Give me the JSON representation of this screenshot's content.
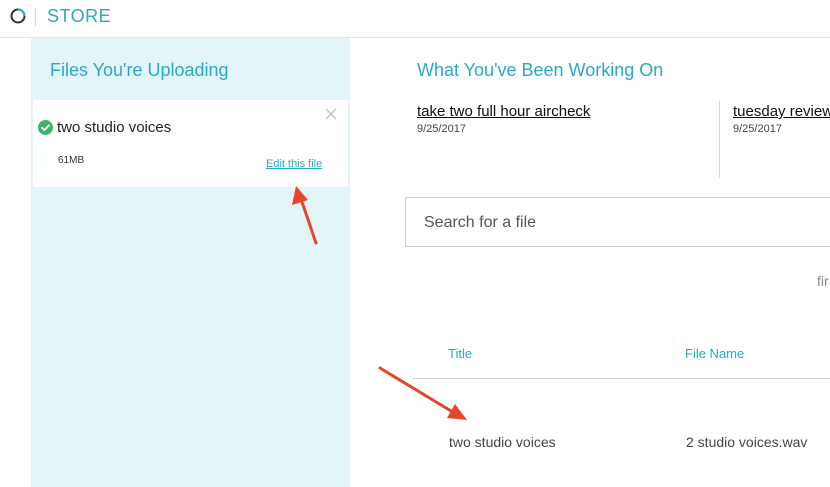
{
  "header": {
    "brand": "STORE"
  },
  "sidebar": {
    "title": "Files You're Uploading",
    "upload": {
      "name": "two studio voices",
      "size": "61MB",
      "edit_label": "Edit this file"
    }
  },
  "main": {
    "title": "What You've Been Working On",
    "recent": [
      {
        "title": "take two full hour aircheck",
        "date": "9/25/2017"
      },
      {
        "title": "tuesday review",
        "date": "9/25/2017"
      }
    ],
    "search": {
      "placeholder": "Search for a file"
    },
    "filter_partial": "fir",
    "table": {
      "columns": [
        "Title",
        "File Name"
      ],
      "rows": [
        {
          "title": "two studio voices",
          "file_name": "2 studio voices.wav"
        }
      ]
    }
  },
  "colors": {
    "accent": "#2aa8c4",
    "sidebar_bg": "#e3f5f9",
    "success": "#3cb56a",
    "annotation_arrow": "#e8462a"
  }
}
